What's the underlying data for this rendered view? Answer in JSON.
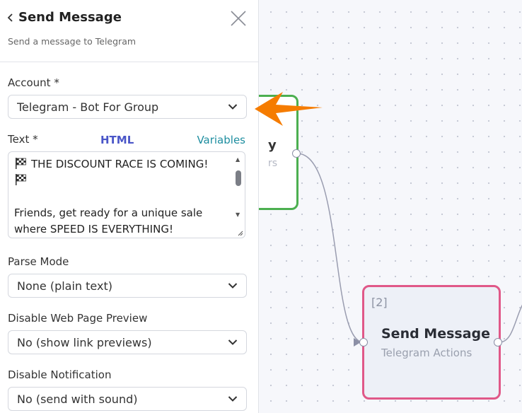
{
  "panel": {
    "title": "Send Message",
    "description": "Send a message to Telegram",
    "fields": {
      "account": {
        "label": "Account *",
        "value": "Telegram - Bot For Group"
      },
      "text": {
        "label": "Text *",
        "html_link": "HTML",
        "variables_link": "Variables",
        "line1": "THE DISCOUNT RACE IS COMING!",
        "line2": "",
        "line3": "",
        "line4": "Friends, get ready for a unique sale",
        "line5": "where SPEED IS EVERYTHING!"
      },
      "parse_mode": {
        "label": "Parse Mode",
        "value": "None (plain text)"
      },
      "disable_preview": {
        "label": "Disable Web Page Preview",
        "value": "No (show link previews)"
      },
      "disable_notification": {
        "label": "Disable Notification",
        "value": "No (send with sound)"
      }
    }
  },
  "canvas": {
    "node_partial": {
      "title": "y",
      "subtitle": "rs"
    },
    "node_send": {
      "index": "[2]",
      "title": "Send Message",
      "subtitle": "Telegram Actions"
    }
  },
  "colors": {
    "accent_arrow": "#f57c00",
    "node_green_border": "#4caf50",
    "node_pink_border": "#e05888",
    "html_link": "#4a56c8",
    "variables_link": "#1e8ea0"
  },
  "icons": [
    "chevron-left-icon",
    "close-icon",
    "chevron-down-icon",
    "checkered-flag-icon",
    "arrow-left-icon"
  ]
}
